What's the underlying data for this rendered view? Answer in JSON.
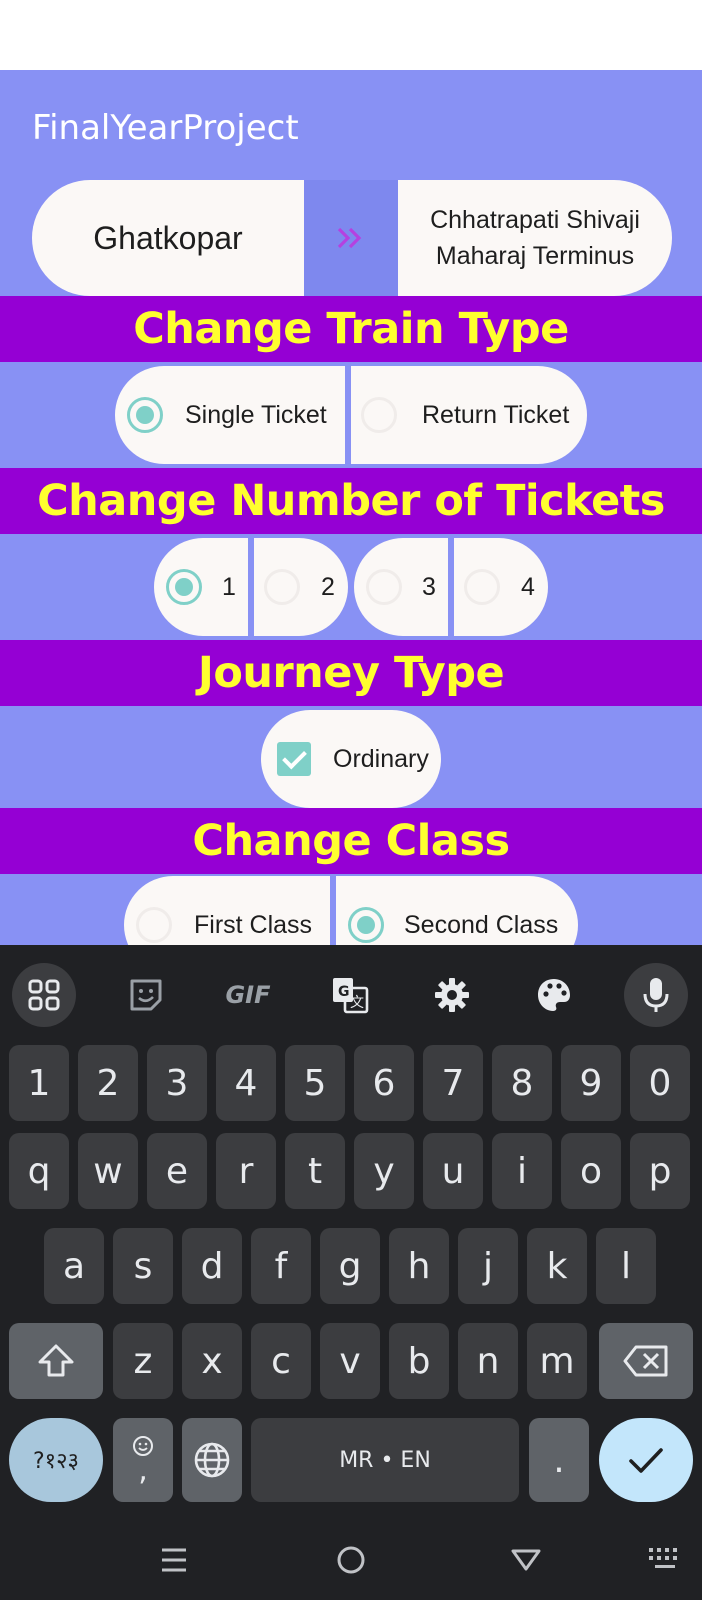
{
  "app_title": "FinalYearProject",
  "route": {
    "from": "Ghatkopar",
    "to": "Chhatrapati Shivaji Maharaj Terminus",
    "swap_icon": "double-chevron-right-icon"
  },
  "sections": {
    "train_type": "Change Train Type",
    "num_tickets": "Change Number of Tickets",
    "journey_type": "Journey Type",
    "class": "Change Class"
  },
  "ticket_type": {
    "options": [
      "Single Ticket",
      "Return Ticket"
    ],
    "selected": "Single Ticket"
  },
  "ticket_count": {
    "options": [
      "1",
      "2",
      "3",
      "4"
    ],
    "selected": "1"
  },
  "journey": {
    "label": "Ordinary",
    "checked": true
  },
  "class_choice": {
    "options": [
      "First Class",
      "Second Class"
    ],
    "selected": "Second Class"
  },
  "keyboard": {
    "toolbar_icons": [
      "apps-grid-icon",
      "sticker-icon",
      "gif-icon",
      "translate-icon",
      "settings-gear-icon",
      "palette-icon",
      "microphone-icon"
    ],
    "gif_label": "GIF",
    "row_numbers": [
      "1",
      "2",
      "3",
      "4",
      "5",
      "6",
      "7",
      "8",
      "9",
      "0"
    ],
    "row1": [
      "q",
      "w",
      "e",
      "r",
      "t",
      "y",
      "u",
      "i",
      "o",
      "p"
    ],
    "row2": [
      "a",
      "s",
      "d",
      "f",
      "g",
      "h",
      "j",
      "k",
      "l"
    ],
    "row3": [
      "z",
      "x",
      "c",
      "v",
      "b",
      "n",
      "m"
    ],
    "symbols_key": "?१२३",
    "emoji_comma_key": ",",
    "space_label": "MR • EN",
    "period_key": ".",
    "accent_color": "#c3e6fb"
  },
  "colors": {
    "app_bar": "#8891f4",
    "section_band": "#9500d4",
    "section_text": "#ffff2e",
    "accent": "#7fd0c8"
  }
}
